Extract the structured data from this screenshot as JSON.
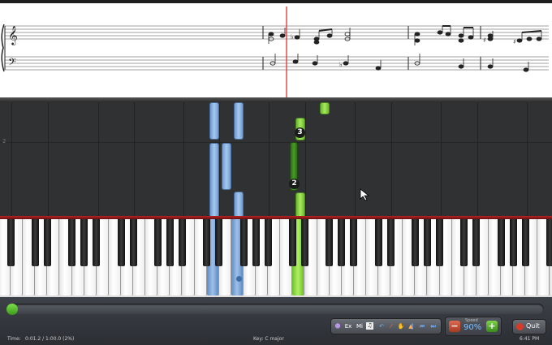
{
  "sheet": {
    "flat_symbol": "♭",
    "sharp_symbol": "♯"
  },
  "roll": {
    "row_label": "2",
    "fingers": [
      "3",
      "2"
    ]
  },
  "status": {
    "time_label": "Time:",
    "time_value": "0:01.2 / 1:00.0 (2%)",
    "key_label": "Key: C major",
    "clock": "6:41 PM",
    "progress_percent": 2
  },
  "toolbar": {
    "ex_label": "Ex",
    "mi_label": "Mi",
    "icons": [
      "person-icon",
      "ex-button",
      "mi-button",
      "sheet-icon",
      "undo-icon",
      "wand-icon",
      "hand-icon",
      "metronome-icon",
      "skip-start-icon",
      "rewind-icon",
      "pause-icon",
      "forward-icon",
      "skip-end-icon"
    ]
  },
  "speed": {
    "label": "Speed",
    "value": "90%",
    "minus": "−",
    "plus": "+"
  },
  "quit": {
    "label": "Quit"
  },
  "colors": {
    "left_hand": "#7ea7dc",
    "right_hand": "#8ad44a",
    "playhead": "#e02020"
  }
}
